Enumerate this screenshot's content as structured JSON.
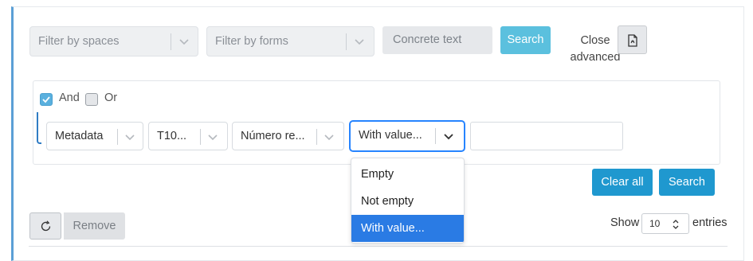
{
  "filters": {
    "spaces_placeholder": "Filter by spaces",
    "forms_placeholder": "Filter by forms",
    "concrete_placeholder": "Concrete text",
    "search_label": "Search",
    "close_advanced_label": "Close\nadvanced"
  },
  "advanced": {
    "and_label": "And",
    "or_label": "Or",
    "and_checked": true,
    "or_checked": false,
    "condition": {
      "field1": "Metadata",
      "field2": "T10...",
      "field3": "Número re...",
      "operator": "With value...",
      "value": ""
    },
    "operator_options": [
      "Empty",
      "Not empty",
      "With value..."
    ],
    "operator_selected": "With value...",
    "clear_all_label": "Clear all",
    "search_label": "Search"
  },
  "table_controls": {
    "remove_label": "Remove",
    "show_label": "Show",
    "page_size": "10",
    "entries_label": "entries"
  },
  "colors": {
    "accent": "#5b9fd6",
    "primary_button": "#1f98cf",
    "light_button": "#5bc0de",
    "selected_option": "#2a7be4"
  }
}
